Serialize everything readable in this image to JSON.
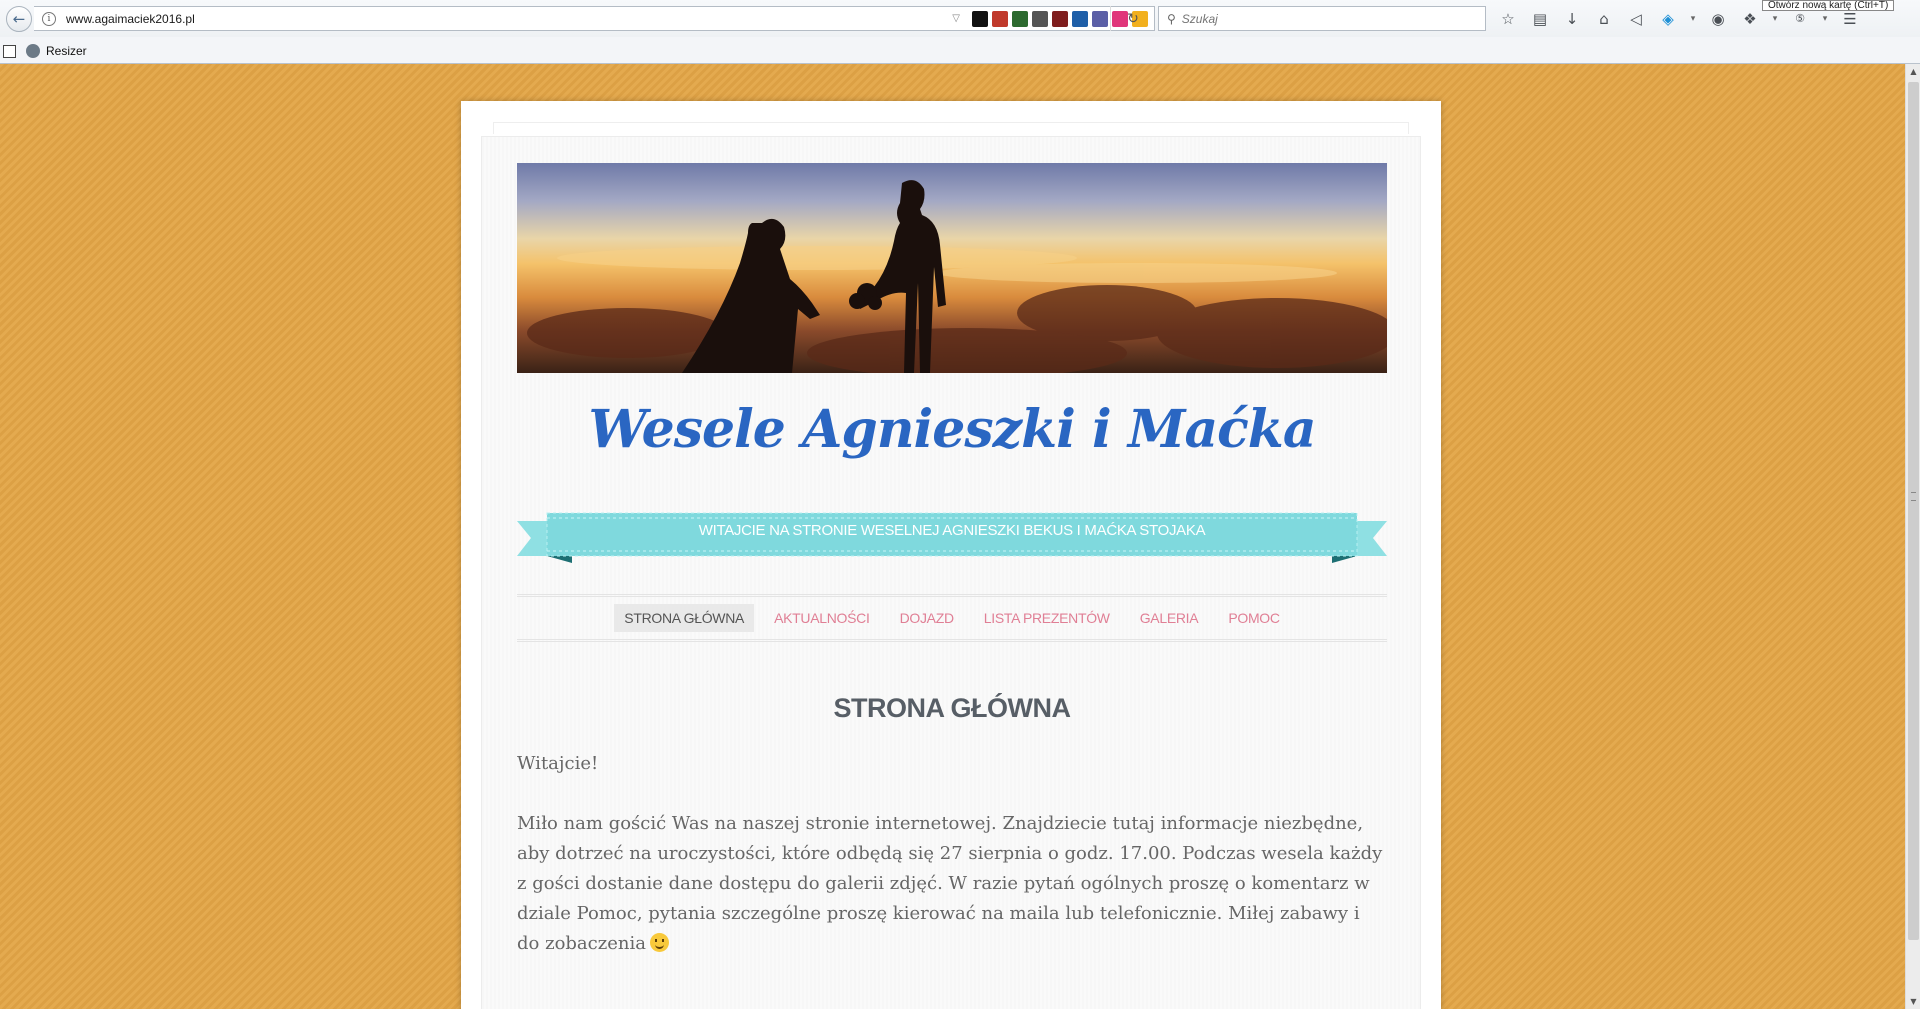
{
  "browser": {
    "url": "www.agaimaciek2016.pl",
    "search_placeholder": "Szukaj",
    "tooltip": "Otwórz nową kartę (Ctrl+T)",
    "bookmarks": [
      {
        "label": "Resizer"
      }
    ],
    "extensions": [
      {
        "name": "flag-extension-icon",
        "color": "#111111"
      },
      {
        "name": "red-extension-icon",
        "color": "#c0392b"
      },
      {
        "name": "l-extension-icon",
        "color": "#2d6a2f"
      },
      {
        "name": "wordpress-icon",
        "color": "#555555"
      },
      {
        "name": "w-extension-icon",
        "color": "#7f1d1d"
      },
      {
        "name": "c-extension-icon",
        "color": "#1f5fa8"
      },
      {
        "name": "php-extension-icon",
        "color": "#5b5fa6"
      },
      {
        "name": "pink-extension-icon",
        "color": "#e0367a"
      },
      {
        "name": "shield-extension-icon",
        "color": "#f2b01e"
      }
    ]
  },
  "site": {
    "title": "Wesele Agnieszki i Maćka",
    "tagline": "Witajcie na stronie weselnej Agnieszki Bekus i Maćka Stojaka",
    "menu": [
      {
        "label": "STRONA GŁÓWNA"
      },
      {
        "label": "AKTUALNOŚCI"
      },
      {
        "label": "DOJAZD"
      },
      {
        "label": "LISTA PREZENTÓW"
      },
      {
        "label": "GALERIA"
      },
      {
        "label": "POMOC"
      }
    ],
    "active_menu": "STRONA GŁÓWNA",
    "page_heading": "STRONA GŁÓWNA",
    "greeting": "Witajcie!",
    "body": "Miło nam gościć Was na naszej stronie internetowej. Znajdziecie tutaj informacje niezbędne, aby dotrzeć na uroczystości, które odbędą się 27 sierpnia o godz. 17.00. Podczas wesela każdy z gości dostanie dane dostępu do galerii zdjęć. W razie pytań ogólnych proszę o komentarz w dziale Pomoc, pytania szczególne proszę kierować na maila lub telefonicznie. Miłej zabawy i do zobaczenia"
  },
  "colors": {
    "background": "#e3a546",
    "title": "#2a66c2",
    "menu_link": "#e07f95",
    "ribbon": "#7fd9dd"
  }
}
